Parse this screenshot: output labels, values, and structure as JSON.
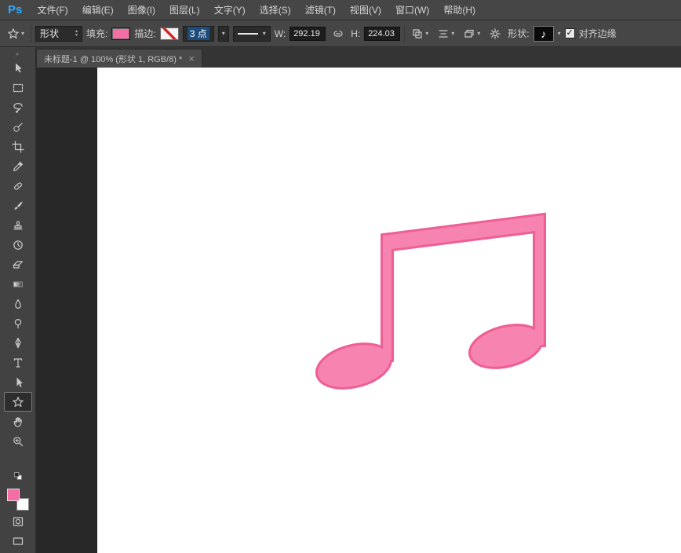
{
  "app": {
    "logo_text": "Ps",
    "logo_color": "#31a8ff"
  },
  "menu": {
    "items": [
      "文件(F)",
      "编辑(E)",
      "图像(I)",
      "图层(L)",
      "文字(Y)",
      "选择(S)",
      "滤镜(T)",
      "视图(V)",
      "窗口(W)",
      "帮助(H)"
    ]
  },
  "options_bar": {
    "tool_mode_value": "形状",
    "fill_label": "填充:",
    "fill_color": "#f46ea5",
    "stroke_label": "描边:",
    "stroke_width_value": "3 点",
    "width_label": "W:",
    "width_value": "292.19",
    "height_label": "H:",
    "height_value": "224.03",
    "shape_label": "形状:",
    "shape_preview_glyph": "♪",
    "align_edges_label": "对齐边缘",
    "align_edges_checked": "✓"
  },
  "document_tab": {
    "title": "未标题-1 @ 100% (形状 1, RGB/8) *",
    "close_glyph": "×"
  },
  "toolbox": {
    "foreground_color": "#f46ea5",
    "background_color": "#ffffff"
  },
  "canvas": {
    "note_fill": "#f783b0",
    "note_stroke": "#ee5f94"
  }
}
